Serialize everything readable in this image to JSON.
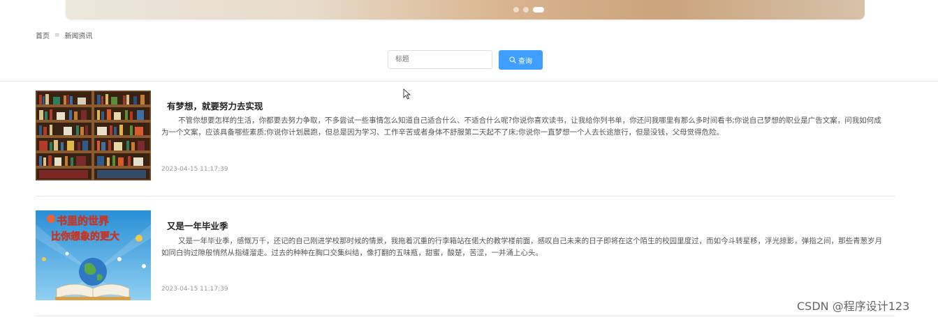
{
  "banner": {
    "active_slide": 3,
    "slide_count": 3
  },
  "breadcrumb": {
    "home": "首页",
    "separator": "≡",
    "current": "新闻资讯"
  },
  "search": {
    "placeholder": "标题",
    "button_label": "查询"
  },
  "news": [
    {
      "title": "有梦想，就要努力去实现",
      "summary": "不管你想要怎样的生活，你都要去努力争取，不多尝试一些事情怎么知道自己适合什么、不适合什么呢?你说你喜欢读书，让我给你列书单，你还问我哪里有那么多时间看书;你说自己梦想的职业是广告文案，问我如何成为一个文案，应该具备哪些素质;你说你计划晨跑，但总是因为学习、工作辛苦或者身体不舒服第二天起不了床;你说你一直梦想一个人去长途旅行，但是没钱，父母觉得危险。",
      "date": "2023-04-15 11:17:39",
      "image": "bookshelf"
    },
    {
      "title": "又是一年毕业季",
      "summary": "又是一年毕业季，感慨万千，还记的自己刚进学校那时候的情景，我拖着沉重的行李箱站在偌大的教学楼前面，感叹自己未来的日子即将在这个陌生的校园里度过，而如今斗转星移，浮光掠影，弹指之间，那些青葱岁月如同白驹过隙般悄然从指缝溜走。过去的种种在胸口交集纠结，像打翻的五味瓶，甜蜜，酸楚，苦涩，一并涌上心头。",
      "date": "2023-04-15 11:17:39",
      "image": "book-world-poster",
      "image_text": [
        "书里的世界",
        "比你想象的更大"
      ]
    }
  ],
  "watermark": "CSDN @程序设计123",
  "colors": {
    "primary": "#409eff",
    "divider": "#e6e6e6"
  }
}
